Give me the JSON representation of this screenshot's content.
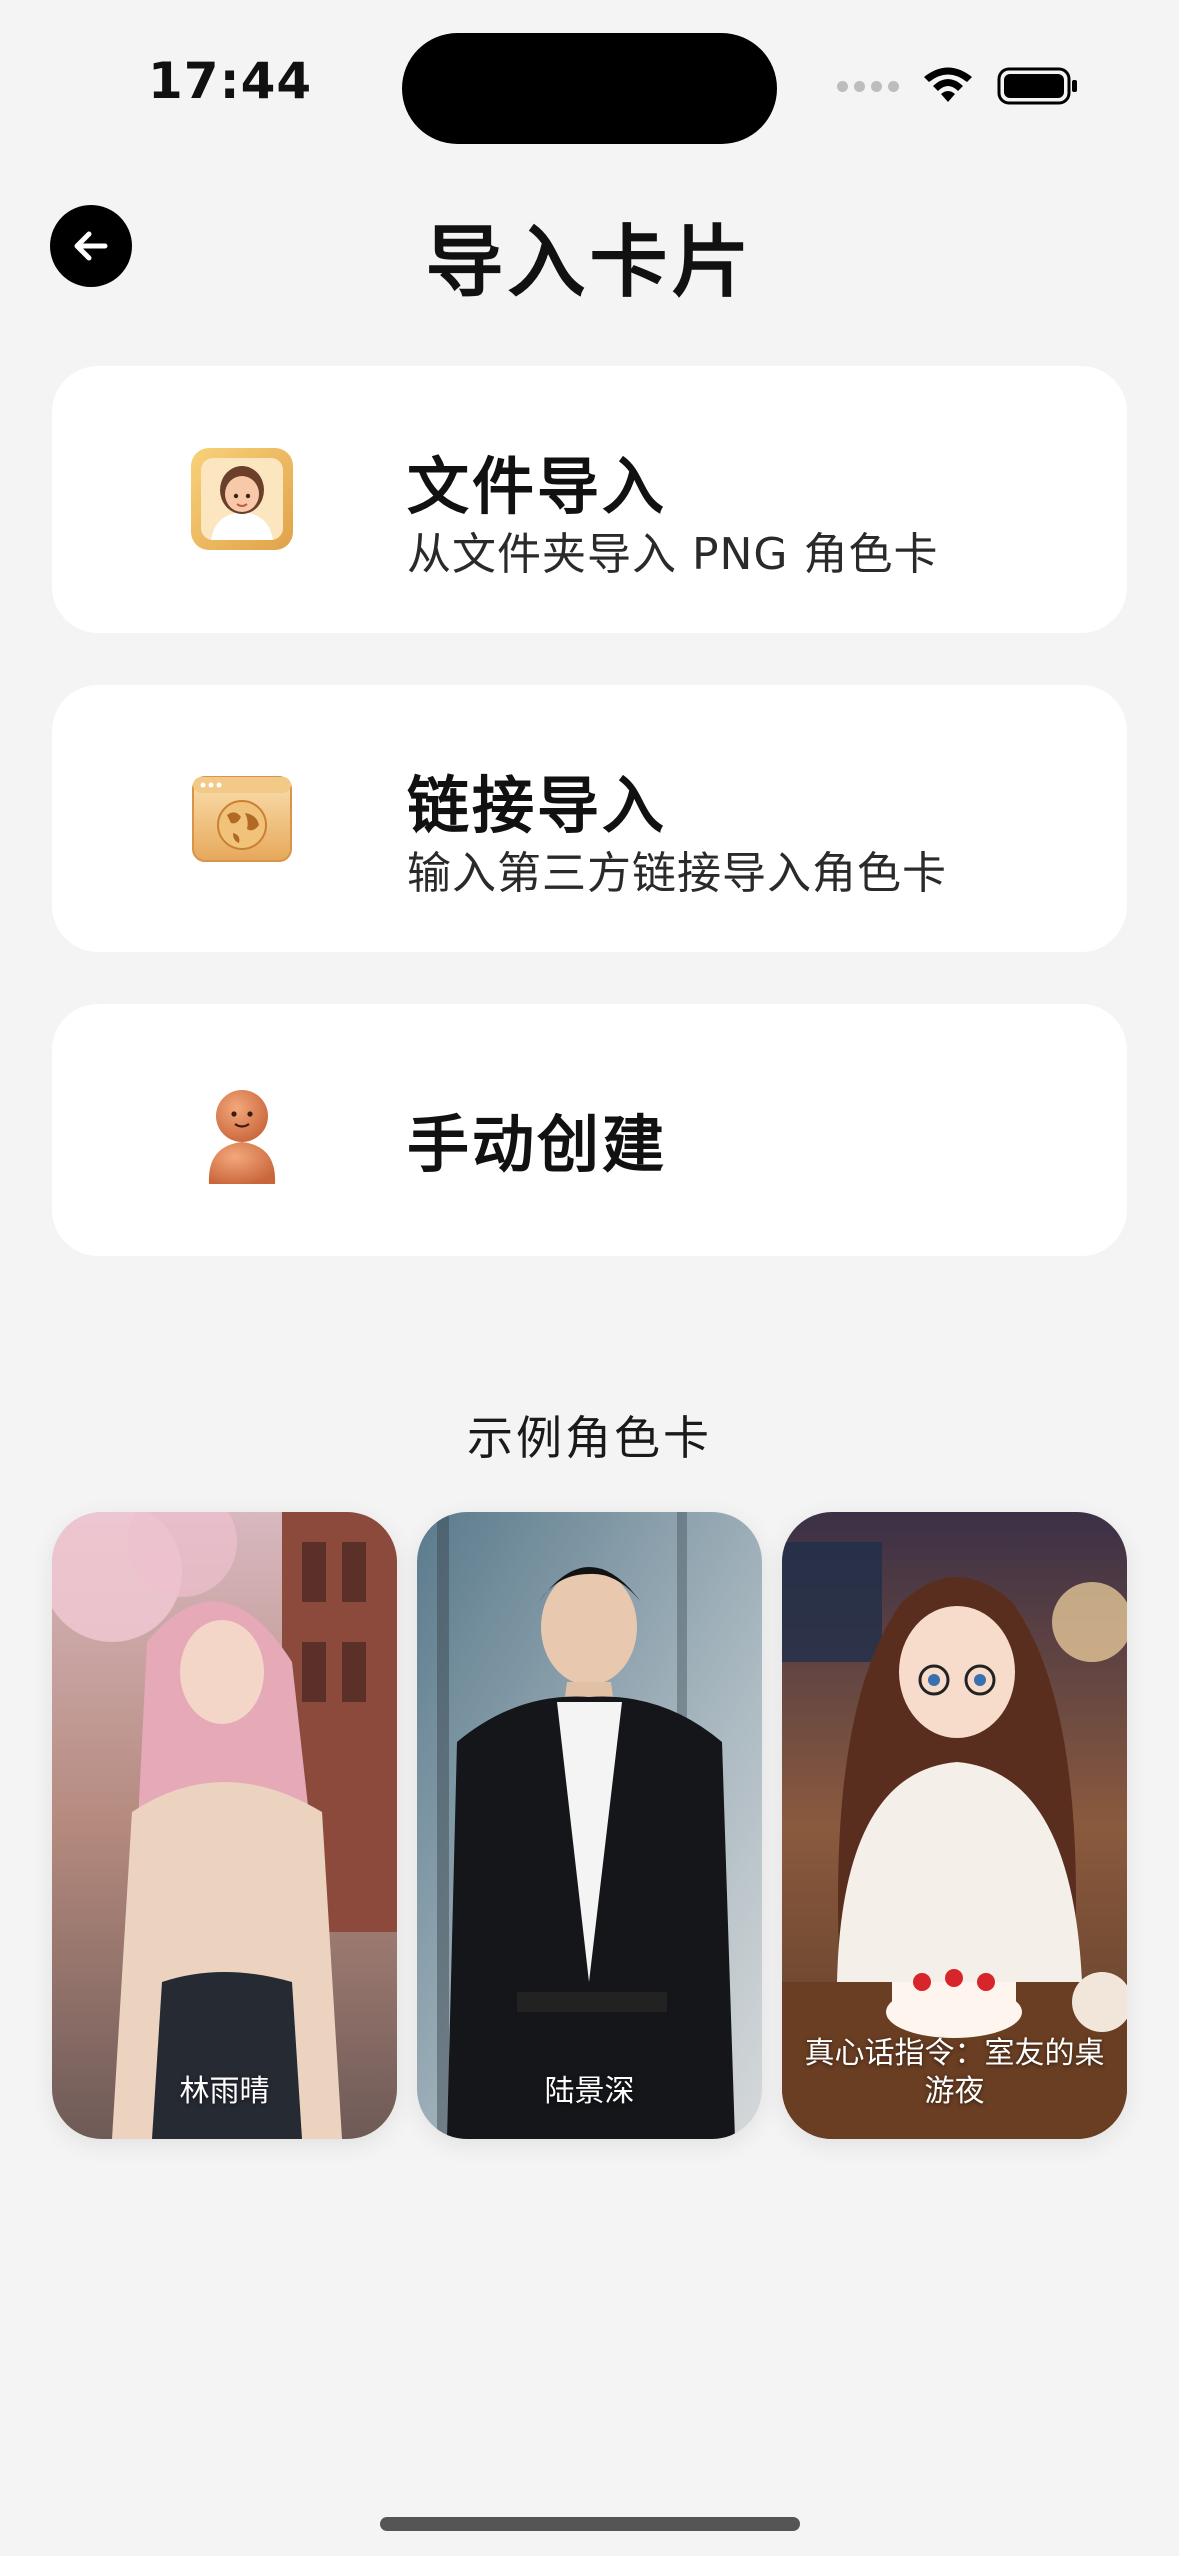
{
  "status_bar": {
    "time": "17:44"
  },
  "header": {
    "title": "导入卡片"
  },
  "options": [
    {
      "title": "文件导入",
      "subtitle": "从文件夹导入 PNG 角色卡",
      "icon": "portrait-card-icon"
    },
    {
      "title": "链接导入",
      "subtitle": "输入第三方链接导入角色卡",
      "icon": "globe-window-icon"
    },
    {
      "title": "手动创建",
      "icon": "clay-figure-icon"
    }
  ],
  "examples": {
    "title": "示例角色卡",
    "items": [
      {
        "name": "林雨晴"
      },
      {
        "name": "陆景深"
      },
      {
        "name": "真心话指令：室友的桌游夜"
      }
    ]
  },
  "colors": {
    "background": "#f4f4f4",
    "card": "#ffffff",
    "accent": "#000000"
  }
}
